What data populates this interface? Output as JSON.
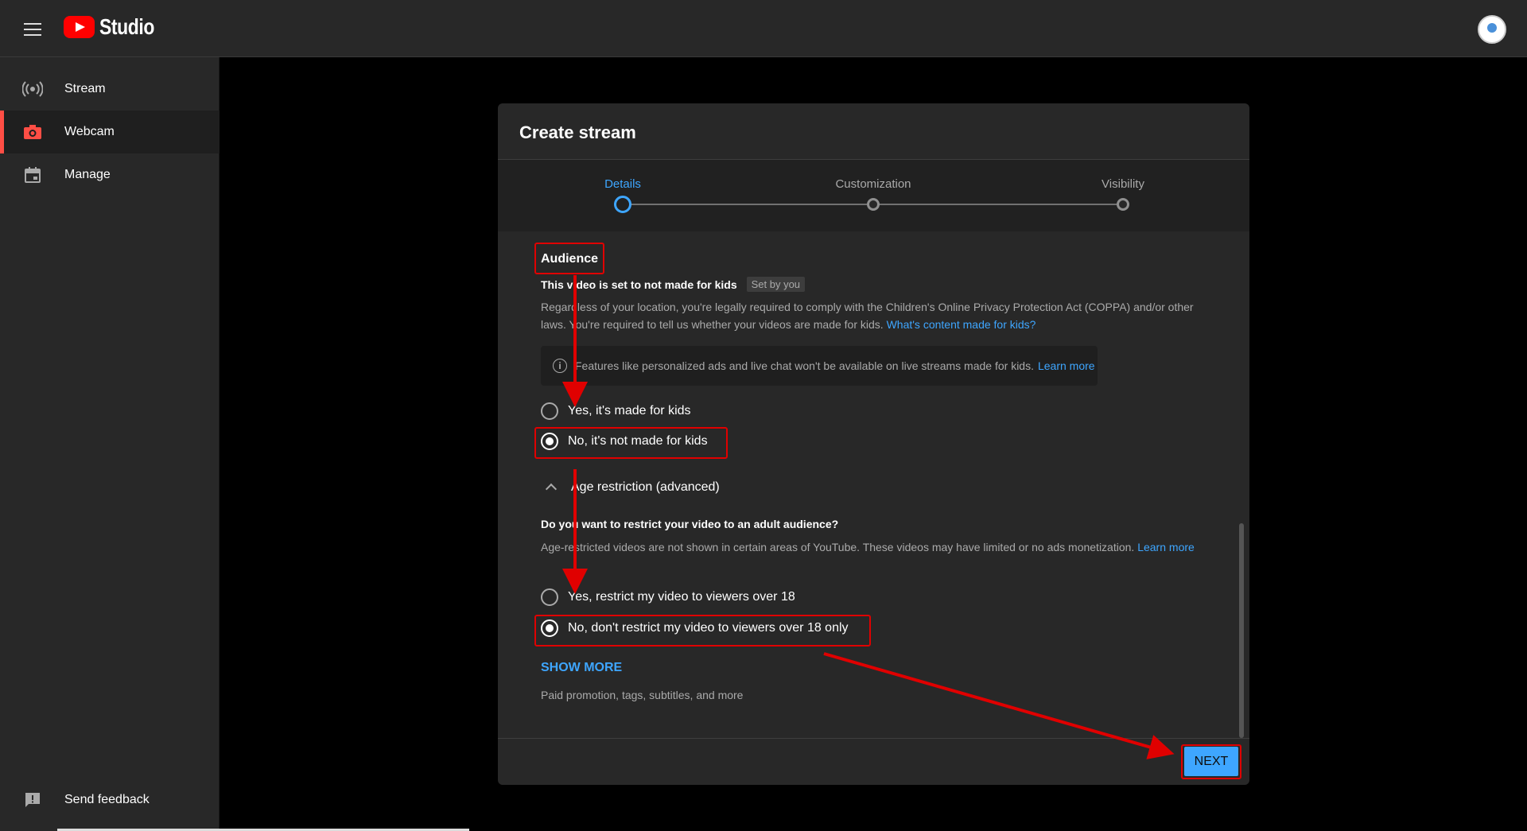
{
  "app": {
    "brand": "Studio"
  },
  "colors": {
    "accent": "#3ea6ff",
    "brand_red": "#ff0000",
    "annotation_red": "#e00000"
  },
  "icons": {
    "menu": "hamburger-icon",
    "stream": "broadcast-icon",
    "webcam": "camera-icon",
    "manage": "calendar-icon",
    "feedback": "feedback-icon",
    "info": "info-icon"
  },
  "sidebar": {
    "items": [
      {
        "label": "Stream",
        "active": false
      },
      {
        "label": "Webcam",
        "active": true
      },
      {
        "label": "Manage",
        "active": false
      }
    ],
    "feedback_label": "Send feedback"
  },
  "dialog": {
    "title": "Create stream",
    "steps": [
      {
        "label": "Details",
        "active": true
      },
      {
        "label": "Customization",
        "active": false
      },
      {
        "label": "Visibility",
        "active": false
      }
    ],
    "audience": {
      "title": "Audience",
      "status": "This video is set to not made for kids",
      "status_chip": "Set by you",
      "description": "Regardless of your location, you're legally required to comply with the Children's Online Privacy Protection Act (COPPA) and/or other laws. You're required to tell us whether your videos are made for kids.",
      "description_link": "What's content made for kids?",
      "info_text": "Features like personalized ads and live chat won't be available on live streams made for kids.",
      "info_link": "Learn more",
      "options": [
        {
          "label": "Yes, it's made for kids",
          "checked": false
        },
        {
          "label": "No, it's not made for kids",
          "checked": true
        }
      ]
    },
    "age_restriction": {
      "toggle_label": "Age restriction (advanced)",
      "question": "Do you want to restrict your video to an adult audience?",
      "description": "Age-restricted videos are not shown in certain areas of YouTube. These videos may have limited or no ads monetization.",
      "description_link_1": "Learn",
      "description_link_2": "more",
      "options": [
        {
          "label": "Yes, restrict my video to viewers over 18",
          "checked": false
        },
        {
          "label": "No, don't restrict my video to viewers over 18 only",
          "checked": true
        }
      ]
    },
    "show_more": {
      "label": "SHOW MORE",
      "caption": "Paid promotion, tags, subtitles, and more"
    },
    "next_label": "NEXT"
  }
}
